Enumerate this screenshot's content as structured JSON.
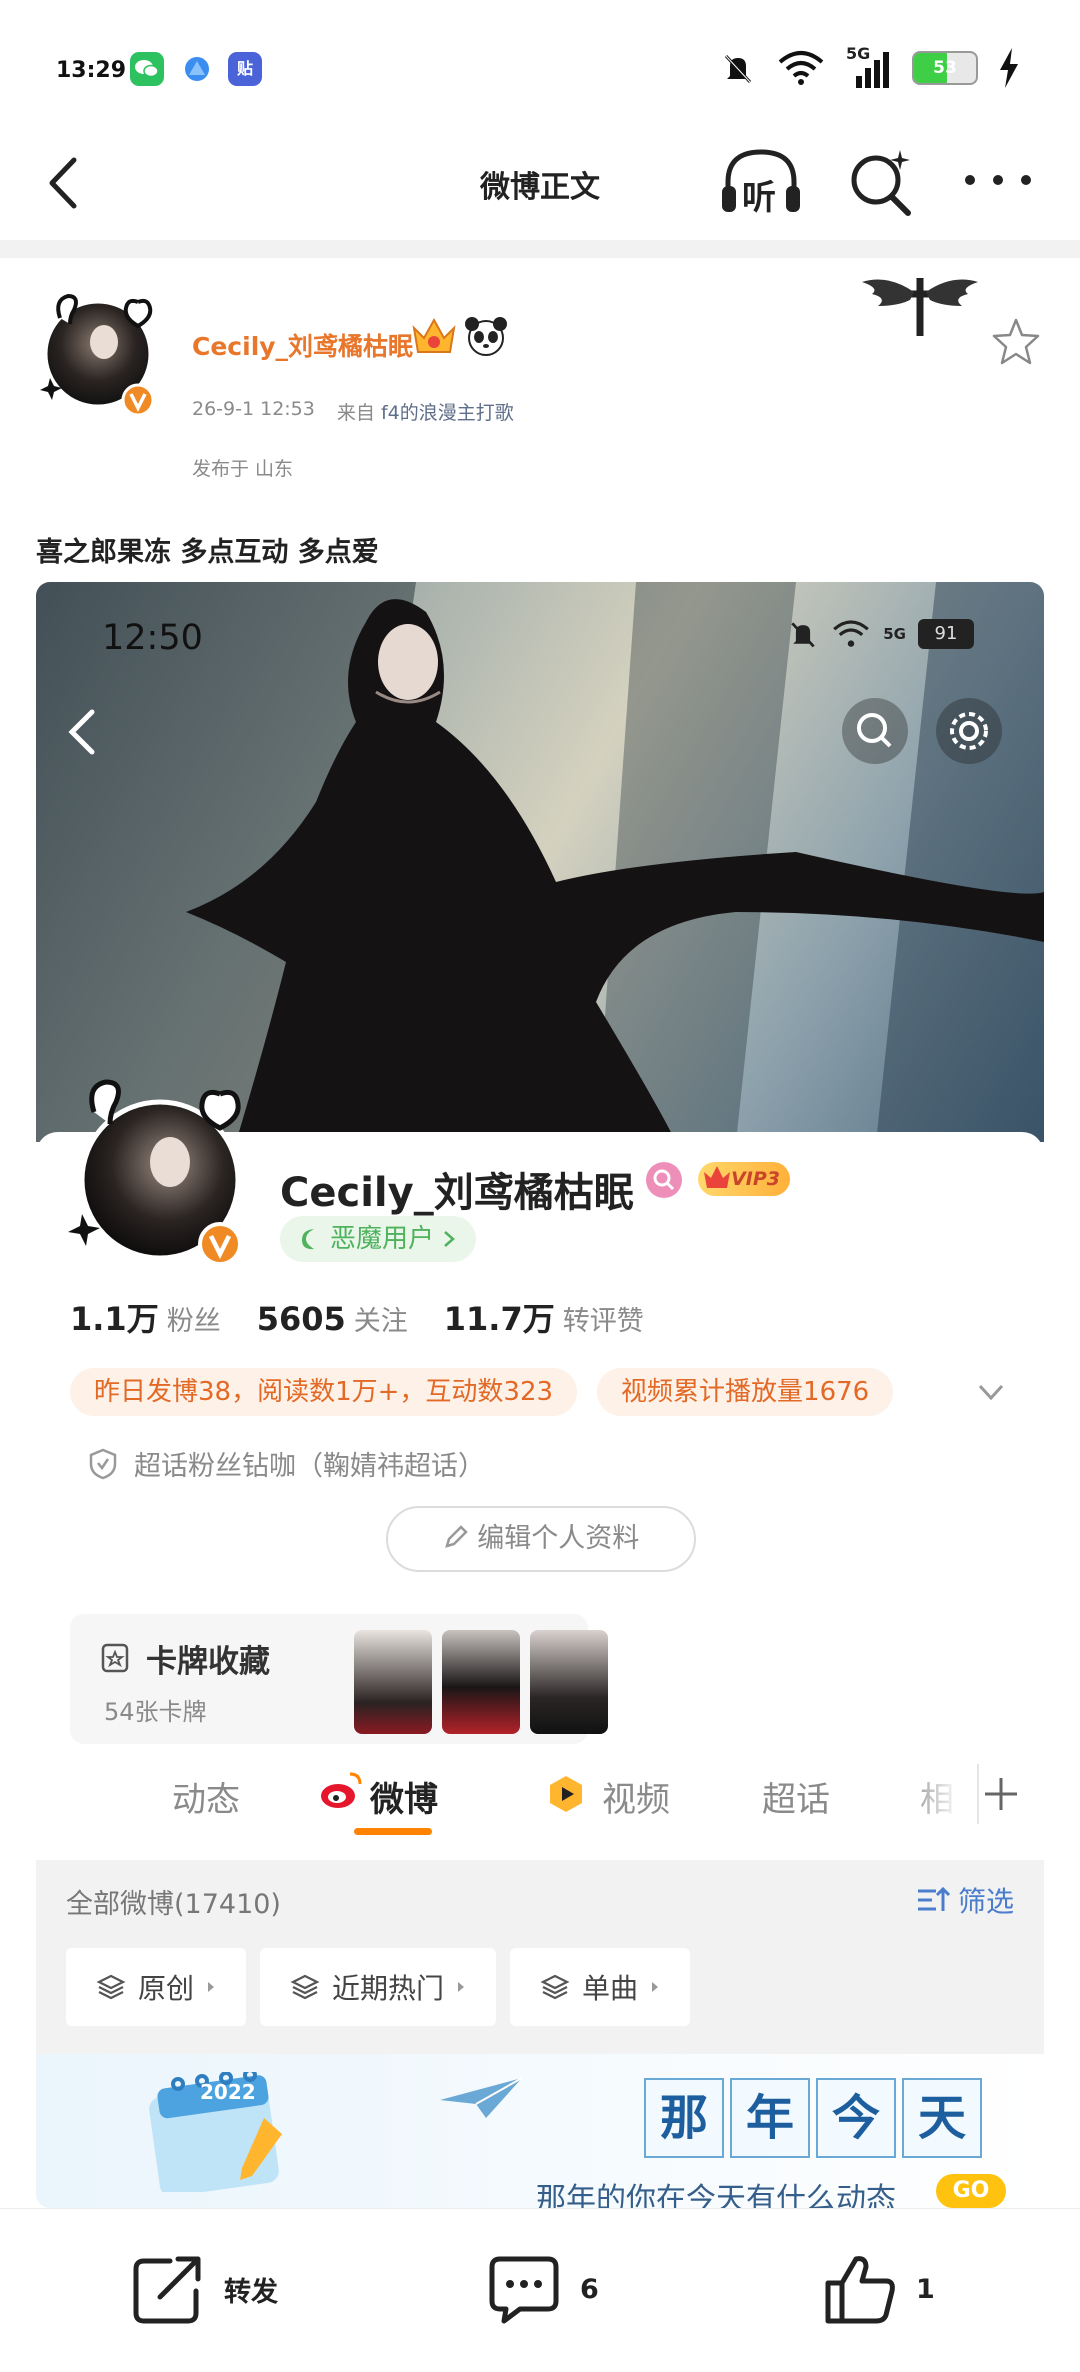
{
  "status_bar": {
    "time": "13:29",
    "apps": [
      "wechat-icon",
      "browser-icon",
      "tieba-icon"
    ],
    "tieba_label": "贴",
    "network": "5G",
    "battery": "53",
    "battery_level": 0.53
  },
  "nav": {
    "title": "微博正文",
    "listen_label": "听",
    "icons": [
      "back-icon",
      "listen-icon",
      "search-icon",
      "more-icon"
    ]
  },
  "post": {
    "author_name": "Cecily_刘鸢橘枯眠",
    "timestamp": "26-9-1 12:53",
    "source_prefix": "来自",
    "source": "f4的浪漫主打歌",
    "location": "发布于 山东",
    "text": "喜之郎果冻 多点互动 多点爱"
  },
  "screenshot": {
    "time": "12:50",
    "network": "5G",
    "battery": "91",
    "profile_name": "Cecily_刘鸢橘枯眠",
    "vip_label": "VIP3",
    "devil_label": "恶魔用户",
    "stats": [
      {
        "num": "1.1万",
        "label": "粉丝"
      },
      {
        "num": "5605",
        "label": "关注"
      },
      {
        "num": "11.7万",
        "label": "转评赞"
      }
    ],
    "tags": [
      "昨日发博38，阅读数1万+，互动数323",
      "视频累计播放量1676"
    ],
    "superfan": "超话粉丝钻咖（鞠婧祎超话）",
    "edit_label": "编辑个人资料",
    "cards_title": "卡牌收藏",
    "cards_count": "54张卡牌",
    "tabs": [
      "动态",
      "微博",
      "视频",
      "超话",
      "相"
    ],
    "active_tab": "微博",
    "feed_count": "全部微博(17410)",
    "filter_label": "筛选",
    "chips": [
      "原创",
      "近期热门",
      "单曲"
    ],
    "banner_chars": [
      "那",
      "年",
      "今",
      "天"
    ],
    "banner_sub": "那年的你在今天有什么动态",
    "banner_go": "GO",
    "calendar_year": "2022"
  },
  "actions": [
    {
      "name": "repost",
      "label": "转发"
    },
    {
      "name": "comment",
      "count": "6"
    },
    {
      "name": "like",
      "count": "1"
    }
  ],
  "colors": {
    "accent": "#ff8200",
    "author_name": "#e8762b",
    "link": "#5f6e8a",
    "devil_green": "#4fb25d",
    "filter_blue": "#4a7dcc"
  }
}
